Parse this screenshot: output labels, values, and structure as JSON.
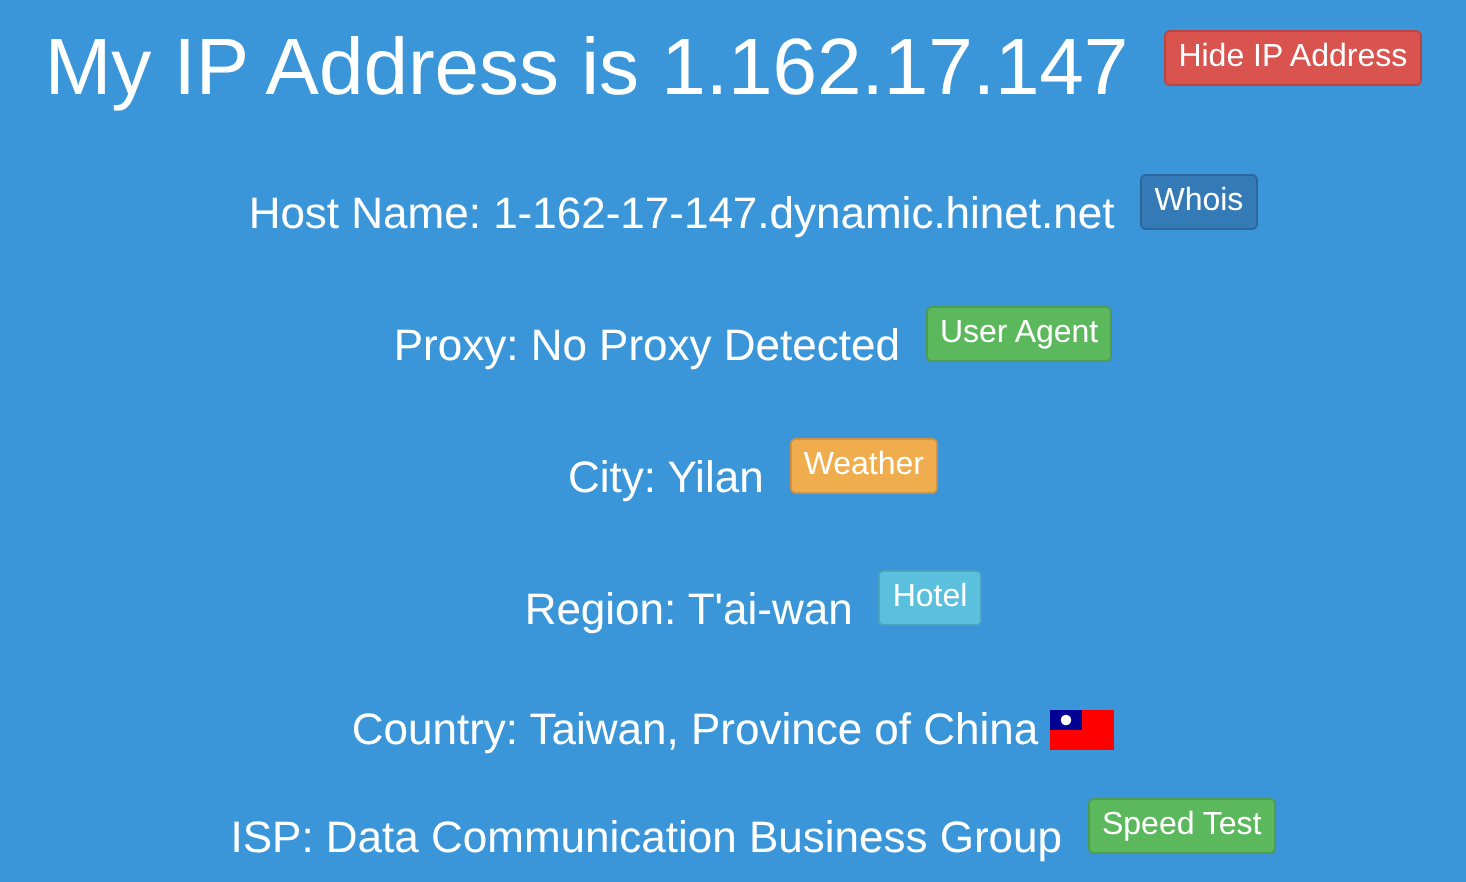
{
  "heading": {
    "text": "My IP Address is 1.162.17.147",
    "button": {
      "label": "Hide IP Address",
      "color": "#d9534f"
    }
  },
  "rows": [
    {
      "text": "Host Name: 1-162-17-147.dynamic.hinet.net",
      "button": {
        "label": "Whois",
        "color": "#337ab7"
      }
    },
    {
      "text": "Proxy: No Proxy Detected",
      "button": {
        "label": "User Agent",
        "color": "#5cb85c"
      }
    },
    {
      "text": "City: Yilan",
      "button": {
        "label": "Weather",
        "color": "#f0ad4e"
      }
    },
    {
      "text": "Region: T'ai-wan",
      "button": {
        "label": "Hotel",
        "color": "#5bc0de"
      }
    },
    {
      "text": "Country: Taiwan, Province of China",
      "flag": true
    },
    {
      "text": "ISP: Data Communication Business Group",
      "button": {
        "label": "Speed Test",
        "color": "#5cb85c"
      }
    }
  ]
}
